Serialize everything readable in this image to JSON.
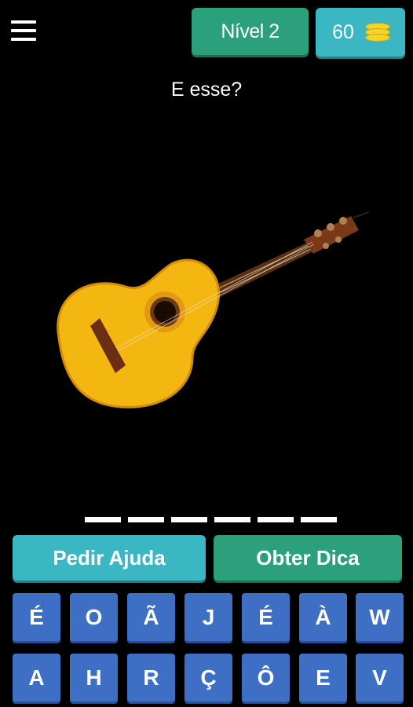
{
  "header": {
    "level_label": "Nível 2",
    "coins": "60"
  },
  "question": "E esse?",
  "image": {
    "subject": "acoustic guitar"
  },
  "answer_slots": 6,
  "actions": {
    "help_label": "Pedir Ajuda",
    "hint_label": "Obter Dica"
  },
  "keyboard": {
    "row1": [
      "É",
      "O",
      "Ã",
      "J",
      "É",
      "À",
      "W"
    ],
    "row2": [
      "A",
      "H",
      "R",
      "Ç",
      "Ô",
      "E",
      "V"
    ]
  },
  "colors": {
    "background": "#000000",
    "level_button": "#2ba07a",
    "coins_button": "#3ab7c2",
    "help_button": "#3ab7c2",
    "hint_button": "#2ba07a",
    "key": "#3d6fc4",
    "coin": "#f5d328"
  }
}
